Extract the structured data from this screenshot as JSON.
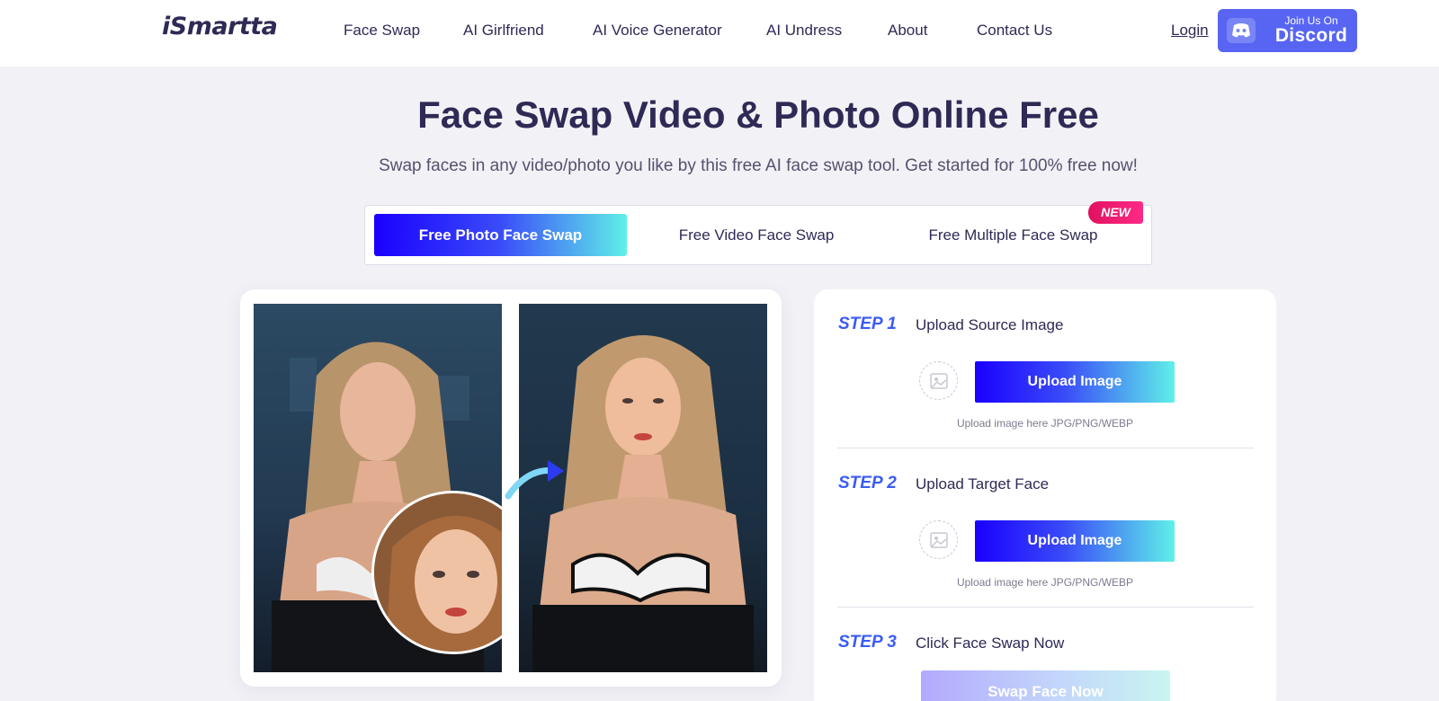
{
  "header": {
    "logo": "iSmartta",
    "nav": [
      "Face Swap",
      "AI Girlfriend",
      "AI Voice Generator",
      "AI Undress",
      "About",
      "Contact Us"
    ],
    "login": "Login",
    "discord_top": "Join Us On",
    "discord_bottom": "Discord"
  },
  "hero": {
    "title": "Face Swap Video & Photo Online Free",
    "subtitle": "Swap faces in any video/photo you like by this free AI face swap tool. Get started for 100% free now!"
  },
  "tabs": {
    "items": [
      "Free Photo Face Swap",
      "Free Video Face Swap",
      "Free Multiple Face Swap"
    ],
    "active": "Free Photo Face Swap",
    "badge": "NEW"
  },
  "steps": [
    {
      "label": "STEP 1",
      "title": "Upload Source Image",
      "button": "Upload Image",
      "hint": "Upload image here JPG/PNG/WEBP"
    },
    {
      "label": "STEP 2",
      "title": "Upload Target Face",
      "button": "Upload Image",
      "hint": "Upload image here JPG/PNG/WEBP"
    },
    {
      "label": "STEP 3",
      "title": "Click Face Swap Now",
      "button": "Swap Face Now"
    }
  ],
  "colors": {
    "brand_dark": "#2e2a55",
    "accent_blue": "#3a5cf5",
    "discord": "#5865f2",
    "badge_pink": "#e0115f"
  }
}
